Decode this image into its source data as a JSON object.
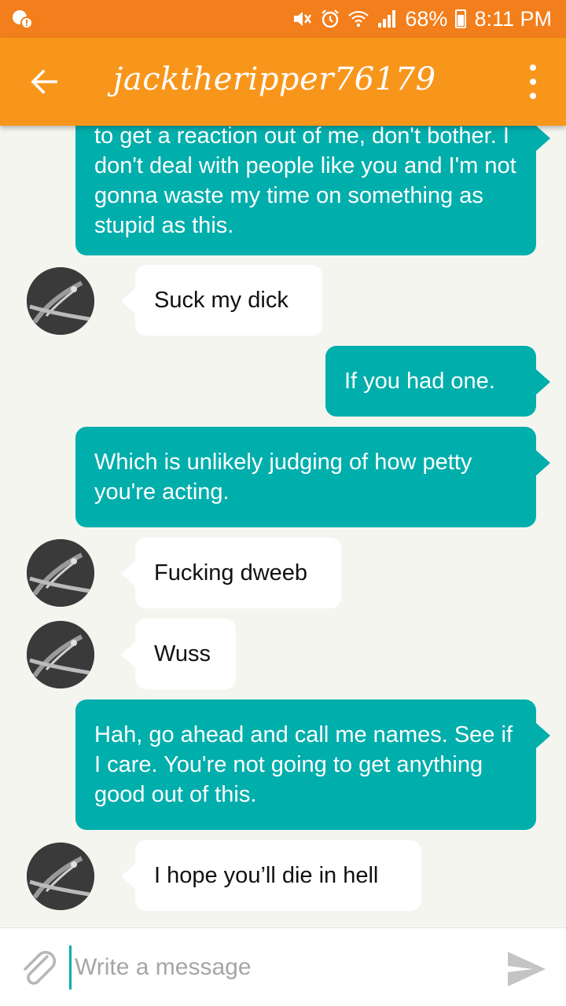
{
  "status_bar": {
    "battery": "68%",
    "time": "8:11 PM"
  },
  "header": {
    "title": "jacktheripper76179"
  },
  "messages": [
    {
      "side": "out",
      "text": "to get a reaction out of me, don't bother. I don't deal with people like you and I'm not gonna waste my time on something as stupid as this."
    },
    {
      "side": "in",
      "text": "Suck my dick"
    },
    {
      "side": "out",
      "text": "If you had one."
    },
    {
      "side": "out",
      "text": "Which is unlikely judging of how petty you're acting."
    },
    {
      "side": "in",
      "text": "Fucking dweeb"
    },
    {
      "side": "in",
      "text": "Wuss"
    },
    {
      "side": "out",
      "text": "Hah, go ahead and call me names. See if I care. You're not going to get anything good out of this."
    },
    {
      "side": "in",
      "text": "I hope you’ll die in hell"
    }
  ],
  "composer": {
    "placeholder": "Write a message"
  },
  "colors": {
    "status_bar": "#f27e1c",
    "app_bar": "#f8961c",
    "outgoing_bubble": "#00aeac",
    "incoming_bubble": "#ffffff",
    "background": "#f5f5f0"
  },
  "icons": {
    "status_left": "notification-icon",
    "back": "arrow-left-icon",
    "menu": "more-vert-icon",
    "attach": "paperclip-icon",
    "send": "send-icon"
  }
}
